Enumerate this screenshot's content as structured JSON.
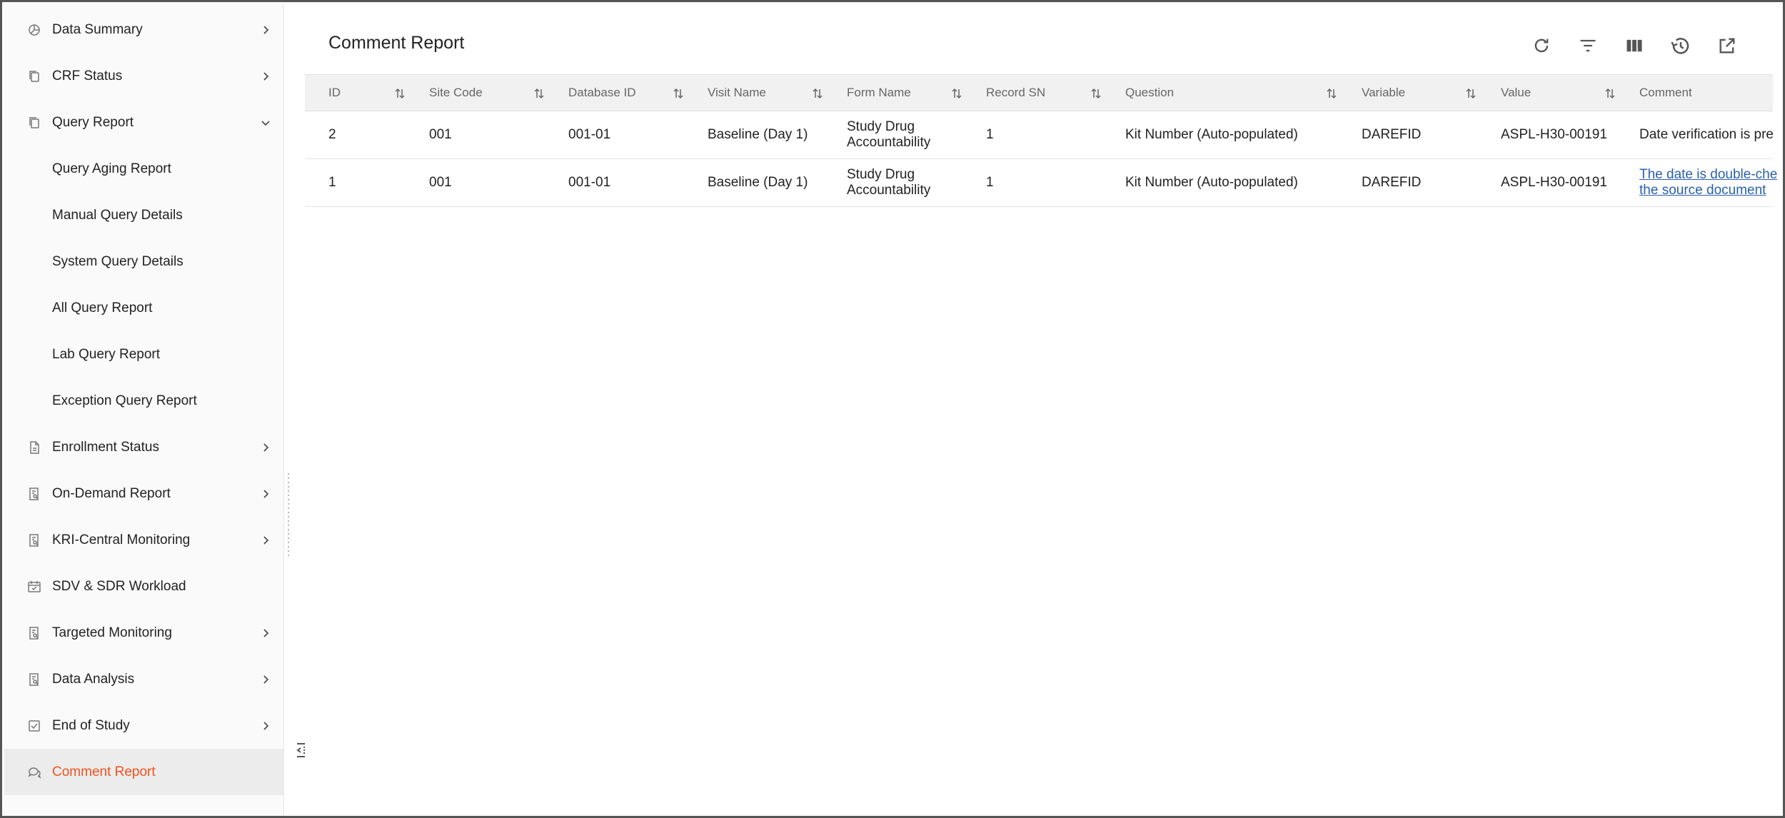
{
  "sidebar": {
    "items": [
      {
        "label": "Data Summary",
        "icon": "chart-pie-icon",
        "chevron": "right",
        "type": "top"
      },
      {
        "label": "CRF Status",
        "icon": "copy-doc-icon",
        "chevron": "right",
        "type": "top"
      },
      {
        "label": "Query Report",
        "icon": "copy-doc-icon",
        "chevron": "down",
        "type": "top"
      },
      {
        "label": "Query Aging Report",
        "type": "sub"
      },
      {
        "label": "Manual Query Details",
        "type": "sub"
      },
      {
        "label": "System Query Details",
        "type": "sub"
      },
      {
        "label": "All Query Report",
        "type": "sub"
      },
      {
        "label": "Lab Query Report",
        "type": "sub"
      },
      {
        "label": "Exception Query Report",
        "type": "sub"
      },
      {
        "label": "Enrollment Status",
        "icon": "document-icon",
        "chevron": "right",
        "type": "top"
      },
      {
        "label": "On-Demand Report",
        "icon": "report-search-icon",
        "chevron": "right",
        "type": "top"
      },
      {
        "label": "KRI-Central Monitoring",
        "icon": "report-search-icon",
        "chevron": "right",
        "type": "top"
      },
      {
        "label": "SDV & SDR Workload",
        "icon": "calendar-check-icon",
        "chevron": "",
        "type": "top"
      },
      {
        "label": "Targeted Monitoring",
        "icon": "report-search-icon",
        "chevron": "right",
        "type": "top"
      },
      {
        "label": "Data Analysis",
        "icon": "report-search-icon",
        "chevron": "right",
        "type": "top"
      },
      {
        "label": "End of Study",
        "icon": "check-square-icon",
        "chevron": "right",
        "type": "top"
      },
      {
        "label": "Comment Report",
        "icon": "comment-icon",
        "chevron": "",
        "type": "top",
        "active": true
      }
    ]
  },
  "header": {
    "title": "Comment Report",
    "tools": [
      "refresh-icon",
      "filter-icon",
      "columns-icon",
      "history-icon",
      "open-external-icon"
    ]
  },
  "table": {
    "columns": [
      "ID",
      "Site Code",
      "Database ID",
      "Visit Name",
      "Form Name",
      "Record SN",
      "Question",
      "Variable",
      "Value",
      "Comment"
    ],
    "rows": [
      {
        "id": "2",
        "site_code": "001",
        "database_id": "001-01",
        "visit_name": "Baseline (Day 1)",
        "form_name": "Study Drug Accountability",
        "record_sn": "1",
        "question": "Kit Number (Auto-populated)",
        "variable": "DAREFID",
        "value": "ASPL-H30-00191",
        "comment": "Date verification is pre"
      },
      {
        "id": "1",
        "site_code": "001",
        "database_id": "001-01",
        "visit_name": "Baseline (Day 1)",
        "form_name": "Study Drug Accountability",
        "record_sn": "1",
        "question": "Kit Number (Auto-populated)",
        "variable": "DAREFID",
        "value": "ASPL-H30-00191",
        "comment": "The date is double-che the source document"
      }
    ]
  },
  "colors": {
    "accent": "#f2511b",
    "link": "#2a5fb0",
    "header_bg": "#f1f1f1",
    "sidebar_bg": "#fafafa",
    "active_bg": "#ececec"
  }
}
